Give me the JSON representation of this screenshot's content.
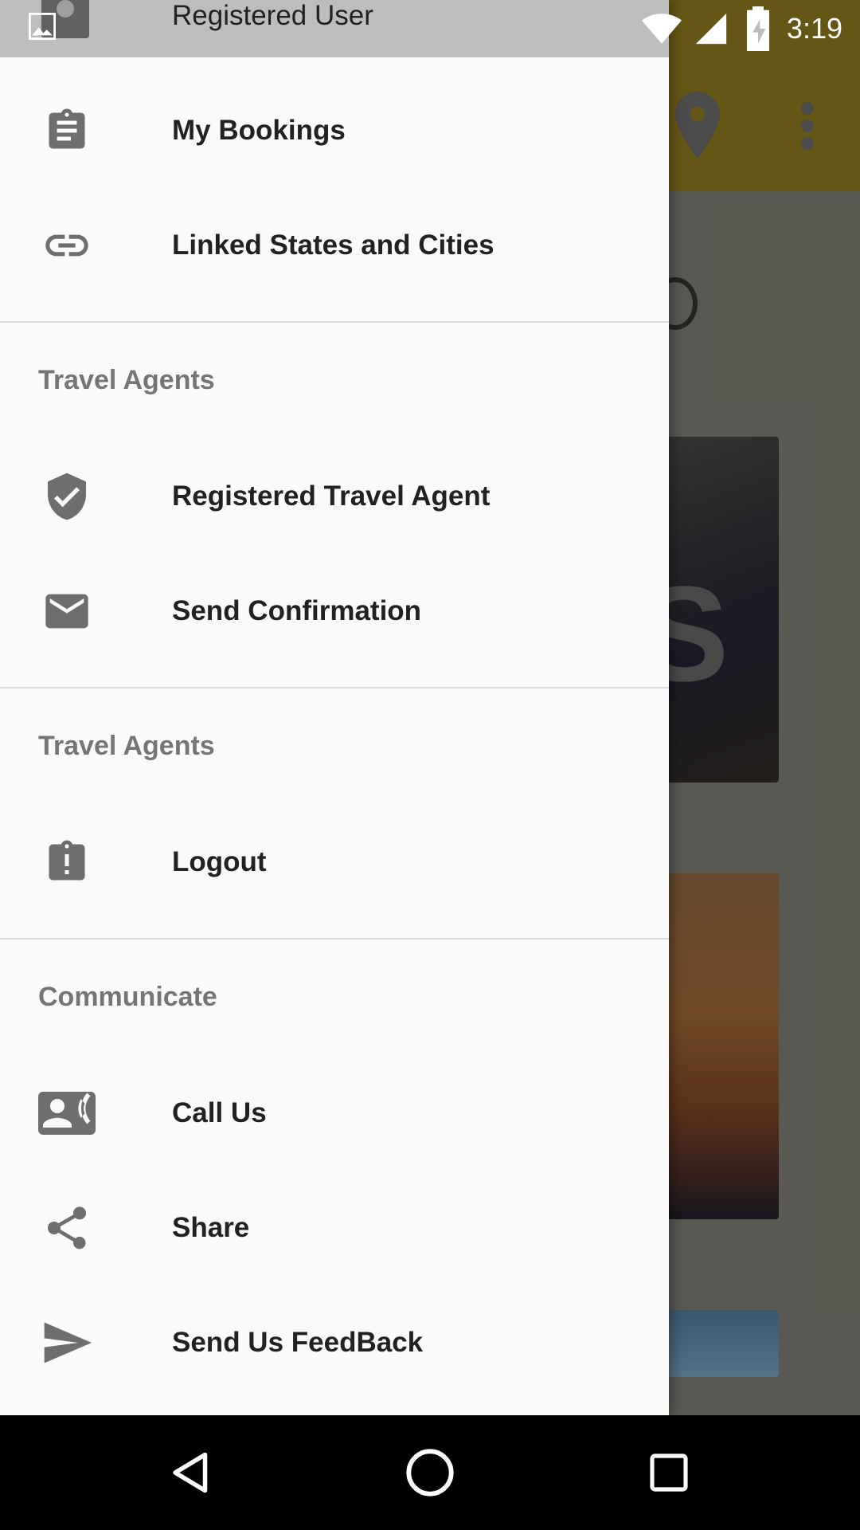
{
  "status_bar": {
    "time": "3:19"
  },
  "drawer": {
    "header": {
      "user_name": "Registered User"
    },
    "items_top": [
      {
        "label": "My Bookings",
        "icon": "clipboard-icon"
      },
      {
        "label": "Linked States and Cities",
        "icon": "link-icon"
      }
    ],
    "sections": [
      {
        "title": "Travel Agents",
        "items": [
          {
            "label": "Registered Travel Agent",
            "icon": "verified-shield-icon"
          },
          {
            "label": "Send Confirmation",
            "icon": "mail-icon"
          }
        ]
      },
      {
        "title": "Travel Agents",
        "items": [
          {
            "label": "Logout",
            "icon": "clipboard-alert-icon"
          }
        ]
      },
      {
        "title": "Communicate",
        "items": [
          {
            "label": "Call Us",
            "icon": "contact-phone-icon"
          },
          {
            "label": "Share",
            "icon": "share-icon"
          },
          {
            "label": "Send Us FeedBack",
            "icon": "send-icon"
          }
        ]
      }
    ]
  },
  "colors": {
    "drawer_bg": "#fafafa",
    "icon": "#6e6e6e",
    "text_primary": "#212121",
    "section_title": "#757575",
    "toolbar_behind": "#7a6a1a"
  }
}
